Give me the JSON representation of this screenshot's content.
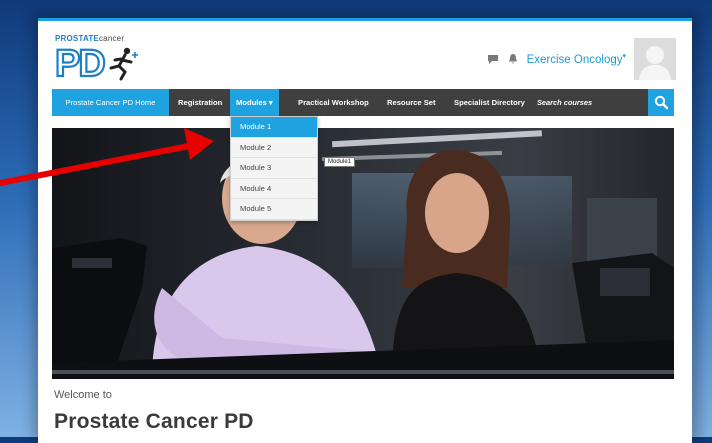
{
  "header": {
    "logo_word_bold": "PROSTATE",
    "logo_word_light": "cancer",
    "logo_letters": "PD",
    "user_name": "Exercise Oncology",
    "user_caret": "▾"
  },
  "nav": {
    "home": "Prostate Cancer PD Home",
    "registration": "Registration",
    "modules": "Modules ▾",
    "practical": "Practical Workshop",
    "resource": "Resource Set",
    "specialist": "Specialist Directory",
    "search_placeholder": "Search courses"
  },
  "modules_menu": {
    "items": [
      "Module 1",
      "Module 2",
      "Module 3",
      "Module 4",
      "Module 5"
    ],
    "active_index": 0,
    "tooltip": "Module1"
  },
  "main": {
    "welcome": "Welcome to",
    "title": "Prostate Cancer PD"
  },
  "colors": {
    "accent": "#1ea3e0",
    "navbar": "#3f3f3f",
    "arrow": "#e60000"
  },
  "icons": [
    "chat-icon",
    "bell-icon",
    "search-icon",
    "user-avatar-icon"
  ]
}
